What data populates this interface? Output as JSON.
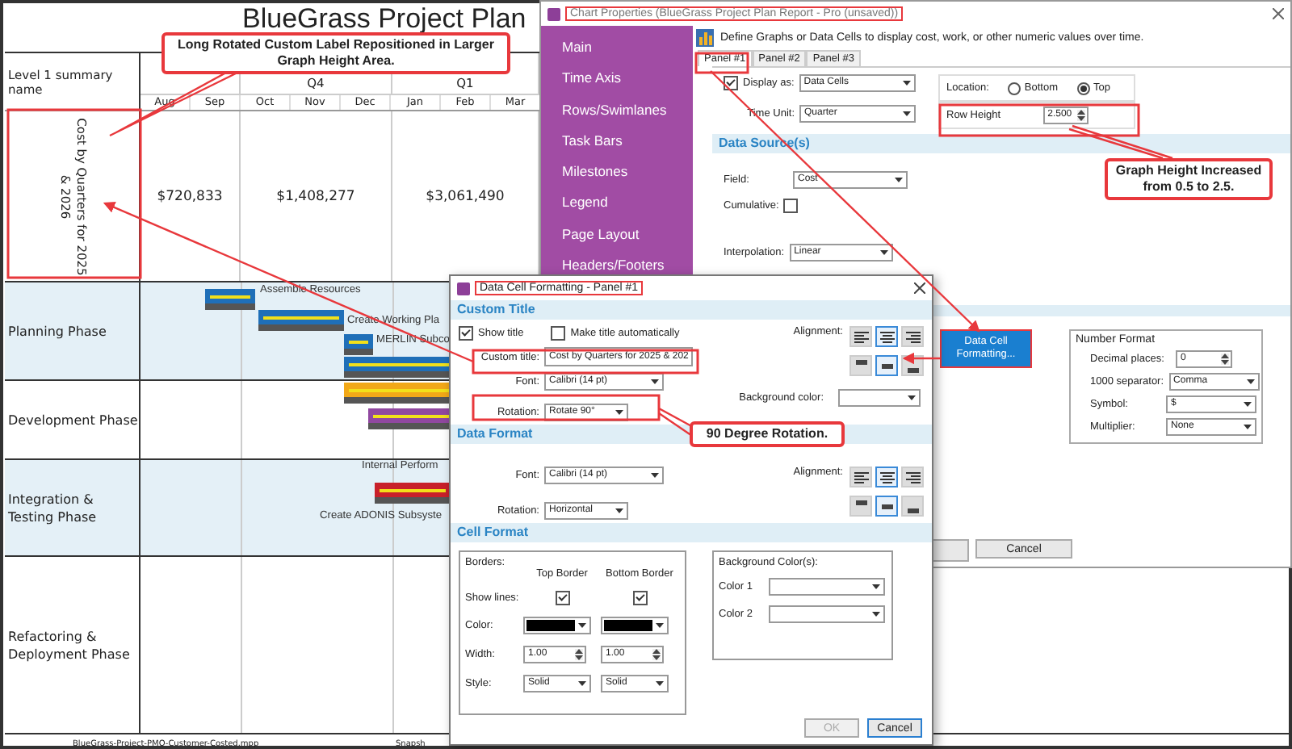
{
  "gantt": {
    "title": "BlueGrass Project Plan",
    "header_label": "Level 1 summary name",
    "quarters": [
      {
        "label": "Q4"
      },
      {
        "label": "Q1"
      }
    ],
    "months": [
      "Aug",
      "Sep",
      "Oct",
      "Nov",
      "Dec",
      "Jan",
      "Feb",
      "Mar"
    ],
    "data_row": {
      "label": "Cost by Quarters for 2025 & 2026",
      "values": [
        "$720,833",
        "$1,408,277",
        "$3,061,490"
      ]
    },
    "phases": [
      {
        "name": "Planning Phase",
        "shaded": true
      },
      {
        "name": "Development Phase",
        "shaded": false
      },
      {
        "name": "Integration & Testing Phase",
        "shaded": true
      },
      {
        "name": "Refactoring & Deployment Phase",
        "shaded": false
      }
    ],
    "bars": [
      {
        "label": "Assemble Resources",
        "color": "#1f6fb8"
      },
      {
        "label": "Create Working Pla",
        "color": "#1f6fb8"
      },
      {
        "label": "MERLIN Subco",
        "color": "#1f6fb8"
      },
      {
        "color": "#1f6fb8"
      },
      {
        "color": "#f2a818"
      },
      {
        "color": "#9048a0"
      },
      {
        "label": "Internal Perform"
      },
      {
        "label": "Create ADONIS Subsyste",
        "color": "#c8202a"
      }
    ],
    "footer": "BlueGrass-Project-PMO-Customer-Costed.mpp",
    "footer_2": "Snapsh"
  },
  "chart_properties": {
    "title": "Chart Properties (BlueGrass Project Plan Report - Pro (unsaved))",
    "sidebar": [
      "Main",
      "Time Axis",
      "Rows/Swimlanes",
      "Task Bars",
      "Milestones",
      "Legend",
      "Page Layout",
      "Headers/Footers"
    ],
    "description": "Define Graphs or Data Cells to display cost, work, or other numeric values over time.",
    "tabs": [
      {
        "label": "Panel #1",
        "selected": true
      },
      {
        "label": "Panel #2",
        "selected": false
      },
      {
        "label": "Panel #3",
        "selected": false
      }
    ],
    "display_as": {
      "label": "Display as:",
      "checked": true,
      "value": "Data Cells"
    },
    "time_unit": {
      "label": "Time Unit:",
      "value": "Quarter"
    },
    "location": {
      "label": "Location:",
      "options": [
        {
          "label": "Bottom",
          "selected": false
        },
        {
          "label": "Top",
          "selected": true
        }
      ]
    },
    "row_height": {
      "label": "Row Height",
      "value": "2.500"
    },
    "data_source": {
      "title": "Data Source(s)",
      "field_label": "Field:",
      "field": "Cost",
      "cumulative_label": "Cumulative:",
      "cumulative": false,
      "interpolation_label": "Interpolation:",
      "interpolation": "Linear"
    },
    "format_button": "Data Cell Formatting...",
    "number_format": {
      "title": "Number Format",
      "rows": [
        {
          "label": "Decimal places:",
          "value": "0",
          "kind": "spinner"
        },
        {
          "label": "1000 separator:",
          "value": "Comma",
          "kind": "select"
        },
        {
          "label": "Symbol:",
          "value": "$",
          "kind": "select"
        },
        {
          "label": "Multiplier:",
          "value": "None",
          "kind": "select"
        }
      ]
    },
    "cancel": "Cancel"
  },
  "data_cell_formatting": {
    "title": "Data Cell Formatting - Panel #1",
    "custom_title": {
      "heading": "Custom Title",
      "show_title": {
        "label": "Show title",
        "checked": true
      },
      "auto_title": {
        "label": "Make title automatically",
        "checked": false
      },
      "title_label": "Custom title:",
      "title_value": "Cost by Quarters for 2025 & 202",
      "font_label": "Font:",
      "font": "Calibri (14 pt)",
      "rotation_label": "Rotation:",
      "rotation": "Rotate 90°",
      "alignment_label": "Alignment:",
      "h_align": [
        {
          "selected": false
        },
        {
          "selected": true
        },
        {
          "selected": false
        }
      ],
      "v_align": [
        {
          "selected": false
        },
        {
          "selected": true
        },
        {
          "selected": false
        }
      ],
      "background_label": "Background color:"
    },
    "data_format": {
      "heading": "Data Format",
      "font_label": "Font:",
      "font": "Calibri (14 pt)",
      "rotation_label": "Rotation:",
      "rotation": "Horizontal",
      "alignment_label": "Alignment:",
      "h_align": [
        {
          "selected": false
        },
        {
          "selected": true
        },
        {
          "selected": false
        }
      ],
      "v_align": [
        {
          "selected": false
        },
        {
          "selected": true
        },
        {
          "selected": false
        }
      ]
    },
    "cell_format": {
      "heading": "Cell Format",
      "borders_label": "Borders:",
      "columns": [
        "Top Border",
        "Bottom Border"
      ],
      "show_lines_label": "Show lines:",
      "show_lines": [
        {
          "checked": true
        },
        {
          "checked": true
        }
      ],
      "color_label": "Color:",
      "width_label": "Width:",
      "widths": [
        "1.00",
        "1.00"
      ],
      "style_label": "Style:",
      "styles": [
        "Solid",
        "Solid"
      ],
      "background_label": "Background Color(s):",
      "colors": [
        "Color 1",
        "Color 2"
      ]
    },
    "ok": {
      "label": "OK",
      "disabled": true
    },
    "cancel": "Cancel"
  },
  "callouts": [
    {
      "text": "Long Rotated Custom Label Repositioned in Larger Graph Height Area."
    },
    {
      "text": "Graph Height Increased from 0.5 to 2.5."
    },
    {
      "text": "90 Degree Rotation."
    }
  ]
}
